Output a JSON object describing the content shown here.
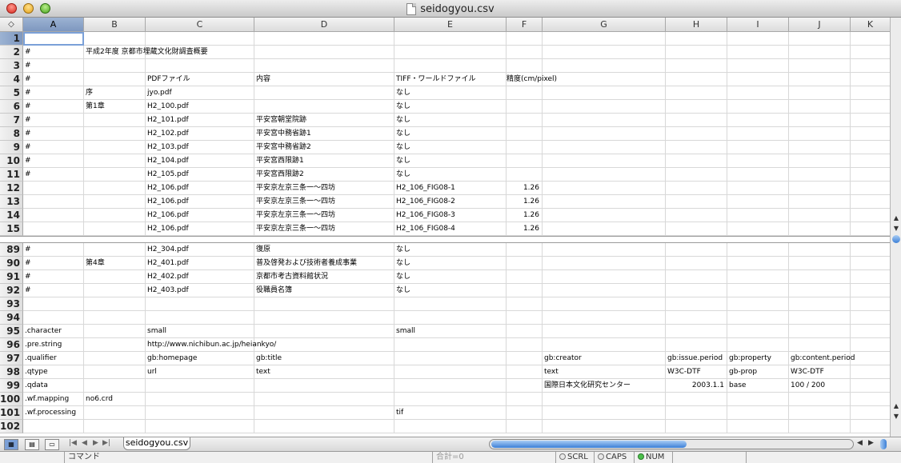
{
  "window": {
    "title": "seidogyou.csv"
  },
  "columns": [
    "A",
    "B",
    "C",
    "D",
    "E",
    "F",
    "G",
    "H",
    "I",
    "J",
    "K"
  ],
  "selected_column": "A",
  "selected_row": "1",
  "rows_top": [
    {
      "n": "1",
      "cells": {}
    },
    {
      "n": "2",
      "cells": {
        "A": "#",
        "B": "平成2年度 京都市埋蔵文化財調査概要"
      }
    },
    {
      "n": "3",
      "cells": {
        "A": "#"
      }
    },
    {
      "n": "4",
      "cells": {
        "A": "#",
        "C": "PDFファイル",
        "D": "内容",
        "E": "TIFF・ワールドファイル",
        "F": "精度(cm/pixel)"
      }
    },
    {
      "n": "5",
      "cells": {
        "A": "#",
        "B": "序",
        "C": "jyo.pdf",
        "E": "なし"
      }
    },
    {
      "n": "6",
      "cells": {
        "A": "#",
        "B": "第1章",
        "C": "H2_100.pdf",
        "E": "なし"
      }
    },
    {
      "n": "7",
      "cells": {
        "A": "#",
        "C": "H2_101.pdf",
        "D": "平安宮朝堂院跡",
        "E": "なし"
      }
    },
    {
      "n": "8",
      "cells": {
        "A": "#",
        "C": "H2_102.pdf",
        "D": "平安宮中務省跡1",
        "E": "なし"
      }
    },
    {
      "n": "9",
      "cells": {
        "A": "#",
        "C": "H2_103.pdf",
        "D": "平安宮中務省跡2",
        "E": "なし"
      }
    },
    {
      "n": "10",
      "cells": {
        "A": "#",
        "C": "H2_104.pdf",
        "D": "平安宮西限跡1",
        "E": "なし"
      }
    },
    {
      "n": "11",
      "cells": {
        "A": "#",
        "C": "H2_105.pdf",
        "D": "平安宮西限跡2",
        "E": "なし"
      }
    },
    {
      "n": "12",
      "cells": {
        "C": "H2_106.pdf",
        "D": "平安京左京三条一〜四坊",
        "E": "H2_106_FIG08-1",
        "F": "1.26"
      }
    },
    {
      "n": "13",
      "cells": {
        "C": "H2_106.pdf",
        "D": "平安京左京三条一〜四坊",
        "E": "H2_106_FIG08-2",
        "F": "1.26"
      }
    },
    {
      "n": "14",
      "cells": {
        "C": "H2_106.pdf",
        "D": "平安京左京三条一〜四坊",
        "E": "H2_106_FIG08-3",
        "F": "1.26"
      }
    },
    {
      "n": "15",
      "cells": {
        "C": "H2_106.pdf",
        "D": "平安京左京三条一〜四坊",
        "E": "H2_106_FIG08-4",
        "F": "1.26"
      }
    }
  ],
  "rows_bottom": [
    {
      "n": "89",
      "cells": {
        "A": "#",
        "C": "H2_304.pdf",
        "D": "復原",
        "E": "なし"
      }
    },
    {
      "n": "90",
      "cells": {
        "A": "#",
        "B": "第4章",
        "C": "H2_401.pdf",
        "D": "普及啓発および技術者養成事業",
        "E": "なし"
      }
    },
    {
      "n": "91",
      "cells": {
        "A": "#",
        "C": "H2_402.pdf",
        "D": "京都市考古資料館状況",
        "E": "なし"
      }
    },
    {
      "n": "92",
      "cells": {
        "A": "#",
        "C": "H2_403.pdf",
        "D": "役職員名簿",
        "E": "なし"
      }
    },
    {
      "n": "93",
      "cells": {}
    },
    {
      "n": "94",
      "cells": {}
    },
    {
      "n": "95",
      "cells": {
        "A": ".character",
        "C": "small",
        "E": "small"
      }
    },
    {
      "n": "96",
      "cells": {
        "A": ".pre.string",
        "C": "http://www.nichibun.ac.jp/heiankyo/"
      }
    },
    {
      "n": "97",
      "cells": {
        "A": ".qualifier",
        "C": "gb:homepage",
        "D": "gb:title",
        "G": "gb:creator",
        "H": "gb:issue.period",
        "I": "gb:property",
        "J": "gb:content.period"
      }
    },
    {
      "n": "98",
      "cells": {
        "A": ".qtype",
        "C": "url",
        "D": "text",
        "G": "text",
        "H": "W3C-DTF",
        "I": "gb-prop",
        "J": "W3C-DTF"
      }
    },
    {
      "n": "99",
      "cells": {
        "A": ".qdata",
        "G": "国際日本文化研究センター",
        "H": "2003.1.1",
        "I": "base",
        "J": "100 / 200"
      }
    },
    {
      "n": "100",
      "cells": {
        "A": ".wf.mapping",
        "B": "no6.crd"
      }
    },
    {
      "n": "101",
      "cells": {
        "A": ".wf.processing",
        "E": "tif"
      }
    },
    {
      "n": "102",
      "cells": {}
    }
  ],
  "sheet_tab": "seidogyou.csv",
  "status": {
    "command": "コマンド",
    "sum": "合計=0",
    "scrl": "SCRL",
    "caps": "CAPS",
    "num": "NUM"
  },
  "icons": {
    "corner": "diamond-sort-icon",
    "view_modes": [
      "normal-view-icon",
      "page-layout-view-icon",
      "page-break-view-icon"
    ]
  },
  "colors": {
    "selection": "#7e97bf",
    "scroll_thumb": "#3b7fd6",
    "num_led": "#4cc04c"
  }
}
